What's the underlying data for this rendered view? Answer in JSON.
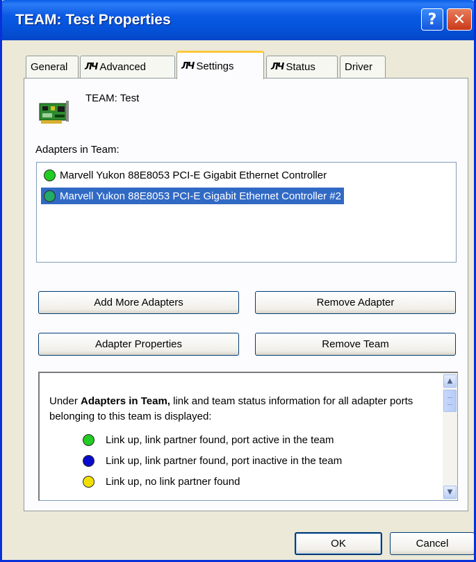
{
  "window": {
    "title": "TEAM: Test Properties",
    "help_label": "?",
    "close_label": "✕"
  },
  "tabs": [
    {
      "label": "General",
      "icon": null
    },
    {
      "label": "Advanced",
      "icon": "marvell-logo-icon"
    },
    {
      "label": "Settings",
      "icon": "marvell-logo-icon",
      "active": true
    },
    {
      "label": "Status",
      "icon": "marvell-logo-icon"
    },
    {
      "label": "Driver",
      "icon": null
    }
  ],
  "tab_icon_glyph": "ЛЧ",
  "team": {
    "name": "TEAM: Test",
    "icon": "network-adapter-icon"
  },
  "adapters": {
    "label": "Adapters in Team:",
    "items": [
      {
        "name": "Marvell Yukon 88E8053 PCI-E Gigabit Ethernet Controller",
        "status_color": "#22cc22",
        "selected": false
      },
      {
        "name": "Marvell Yukon 88E8053 PCI-E Gigabit Ethernet Controller #2",
        "status_color": "#22aa66",
        "selected": true
      }
    ]
  },
  "buttons": {
    "add_more": "Add More Adapters",
    "remove_adapter": "Remove Adapter",
    "adapter_properties": "Adapter Properties",
    "remove_team": "Remove Team",
    "ok": "OK",
    "cancel": "Cancel"
  },
  "info": {
    "intro_prefix": "Under ",
    "intro_bold": "Adapters in Team,",
    "intro_suffix": " link and team status information for all adapter ports belonging to this team is displayed:",
    "legend": [
      {
        "text": "Link up, link partner found, port active in the team",
        "color": "#22cc22"
      },
      {
        "text": "Link up, link partner found, port inactive in the team",
        "color": "#0a0acc"
      },
      {
        "text": "Link up, no link partner found",
        "color": "#f0e000"
      }
    ]
  },
  "colors": {
    "title_bar": "#0a59e3",
    "selection": "#316ac5",
    "active_tab_accent": "#ffc83c"
  }
}
